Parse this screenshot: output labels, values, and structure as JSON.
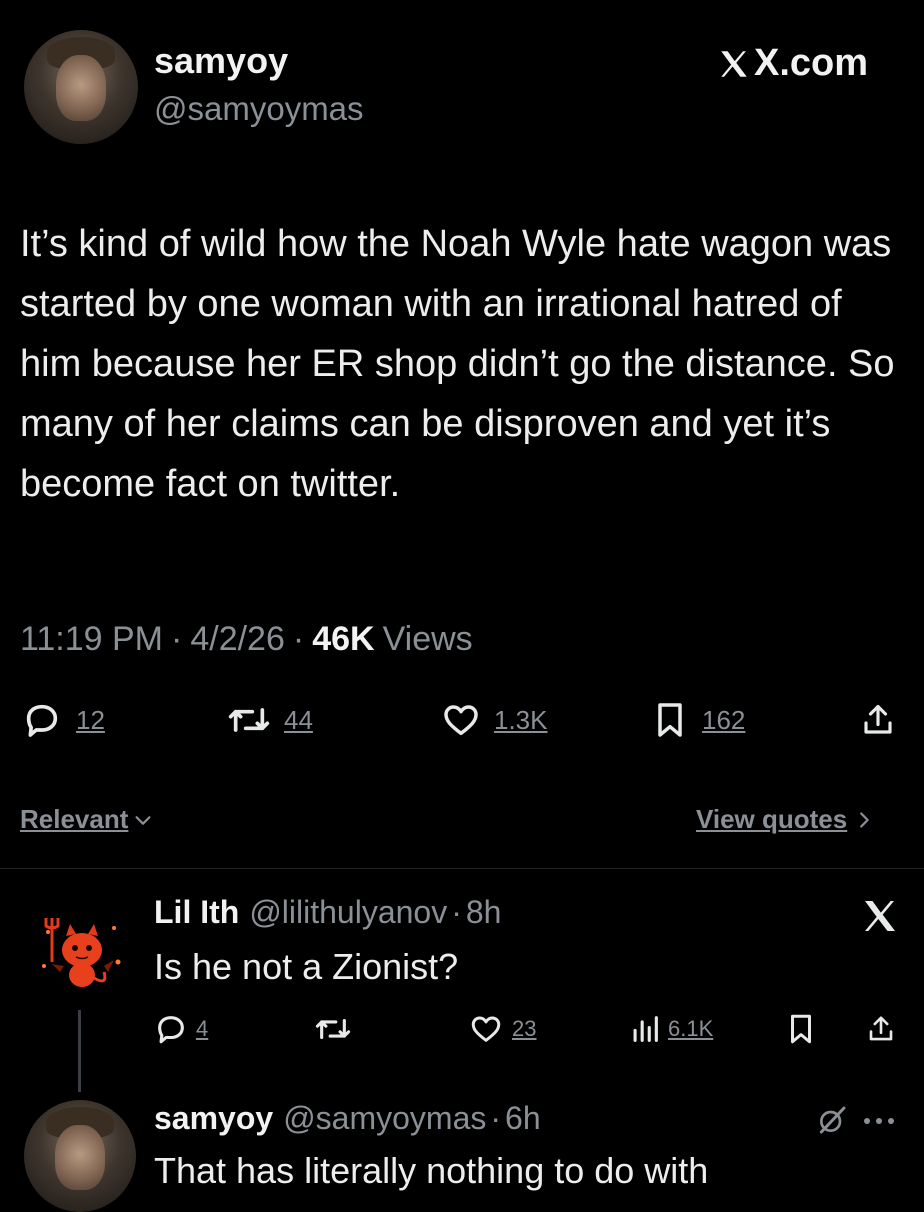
{
  "post": {
    "author_name": "samyoy",
    "author_handle": "@samyoymas",
    "source": "X.com",
    "text": "It’s kind of wild how the Noah Wyle hate wagon was started by one woman with an irrational hatred of him because her ER shop didn’t go the distance. So many of her claims can be disproven and yet it’s become fact on twitter.",
    "time": "11:19 PM",
    "sep": "·",
    "date": "4/2/26",
    "views_count": "46K",
    "views_label": "Views",
    "replies": "12",
    "reposts": "44",
    "likes": "1.3K",
    "bookmarks": "162"
  },
  "sort": {
    "label": "Relevant",
    "view_quotes": "View quotes"
  },
  "reply1": {
    "name": "Lil Ith",
    "handle": "@lilithulyanov",
    "sep": "·",
    "age": "8h",
    "text": "Is he not a Zionist?",
    "replies": "4",
    "likes": "23",
    "views": "6.1K"
  },
  "reply2": {
    "name": "samyoy",
    "handle": "@samyoymas",
    "sep": "·",
    "age": "6h",
    "text": "That has literally nothing to do with"
  },
  "icons": {
    "reply": "reply-icon",
    "repost": "repost-icon",
    "like": "like-icon",
    "bookmark": "bookmark-icon",
    "share": "share-icon",
    "views": "views-icon",
    "x_logo": "x-logo-icon",
    "grok": "grok-icon",
    "more": "more-icon"
  },
  "colors": {
    "background": "#000000",
    "text": "#e7e9ea",
    "muted": "#8b9096"
  }
}
